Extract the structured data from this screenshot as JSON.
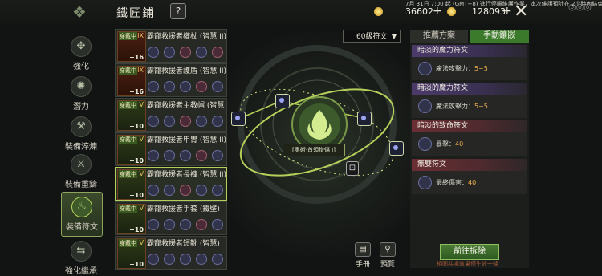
{
  "header": {
    "title": "鐵匠鋪",
    "help": "?",
    "system_line1": "7月 31日 7:00 起 (GMT+8) 進行停服維護作業，本次維護預計在 2小時內結束。",
    "system_line2": "維護後...",
    "currency1": "36602",
    "currency2": "128093",
    "close": "✕"
  },
  "nav": [
    {
      "label": "強化",
      "icon": "enhance-icon"
    },
    {
      "label": "潛力",
      "icon": "potential-icon"
    },
    {
      "label": "裝備淬煉",
      "icon": "anvil-icon"
    },
    {
      "label": "裝備重鑄",
      "icon": "hammer-icon"
    },
    {
      "label": "裝備符文",
      "icon": "rune-icon",
      "active": true
    },
    {
      "label": "強化繼承",
      "icon": "inherit-icon"
    }
  ],
  "items": [
    {
      "name": "霸寵救援者權杖 (智慧 II)",
      "tier": "IX",
      "plus": "+16",
      "wear": "穿戴中"
    },
    {
      "name": "霸寵救援者護盾 (智慧 II)",
      "tier": "IX",
      "plus": "+16",
      "wear": "穿戴中"
    },
    {
      "name": "霸寵救援者主教帽 (智慧 II)",
      "tier": "V",
      "plus": "+10",
      "wear": "穿戴中"
    },
    {
      "name": "霸寵救援者甲胄 (智慧 II)",
      "tier": "V",
      "plus": "+10",
      "wear": "穿戴中"
    },
    {
      "name": "霸寵救援者長褲 (智慧 II)",
      "tier": "V",
      "plus": "+10",
      "wear": "穿戴中"
    },
    {
      "name": "霸寵救援者手套 (鐵壁)",
      "tier": "V",
      "plus": "+10",
      "wear": "穿戴中"
    },
    {
      "name": "霸寵救援者短靴 (智慧)",
      "tier": "V",
      "plus": "+10",
      "wear": "穿戴中"
    }
  ],
  "center": {
    "badge": "[奧術·首領增傷 I]",
    "level_select": "60級符文"
  },
  "tabs": [
    "推薦方案",
    "手動鑲嵌"
  ],
  "runes": [
    {
      "title": "暗淡的魔力符文",
      "stat": "魔法攻擊力：",
      "value": "5~5",
      "color": "purple"
    },
    {
      "title": "暗淡的魔力符文",
      "stat": "魔法攻擊力：",
      "value": "5~5",
      "color": "purple"
    },
    {
      "title": "暗淡的致命符文",
      "stat": "暴擊：",
      "value": "40",
      "color": "red"
    },
    {
      "title": "無雙符文",
      "stat": "最終傷害：",
      "value": "40",
      "color": "red"
    }
  ],
  "actions": {
    "go_button": "前往拆除",
    "note": "相同共鳴效果僅生效一條",
    "manual": "手冊",
    "preview": "預覽"
  },
  "colors": {
    "accent": "#b5d05a",
    "tab_active": "#3a7a2a"
  }
}
